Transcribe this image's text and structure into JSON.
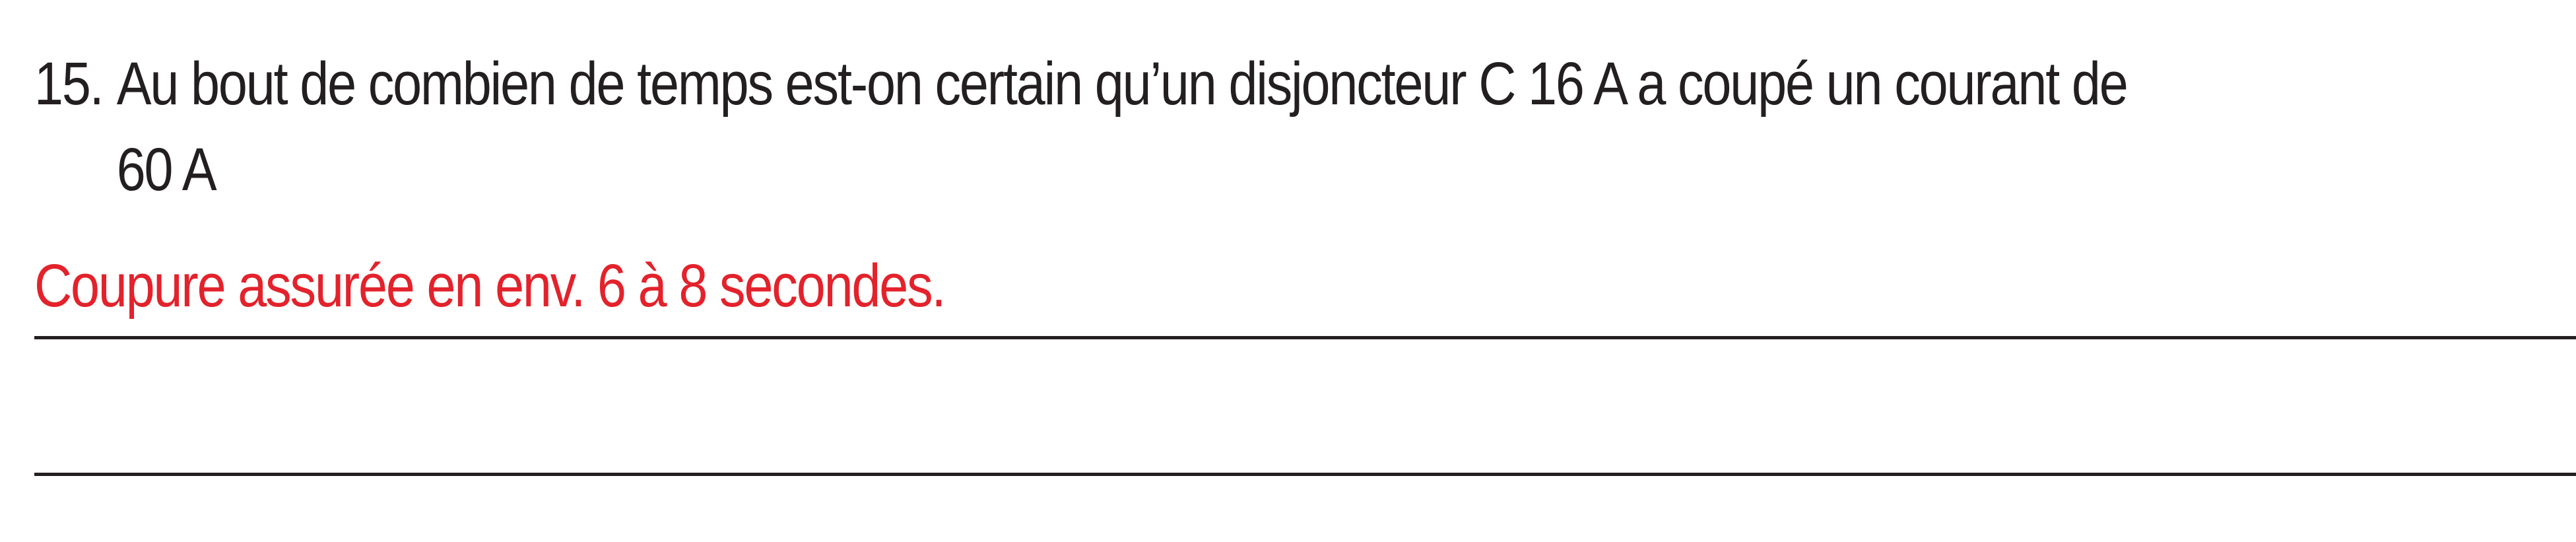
{
  "question": {
    "number": "15.",
    "line1": "Au bout de combien de temps est-on certain qu’un disjoncteur C 16 A a coupé un courant de",
    "line2": "60 A"
  },
  "answer": {
    "text": "Coupure assurée en env. 6 à 8 secondes.",
    "color": "#e3222b"
  },
  "answer_lines": 2
}
